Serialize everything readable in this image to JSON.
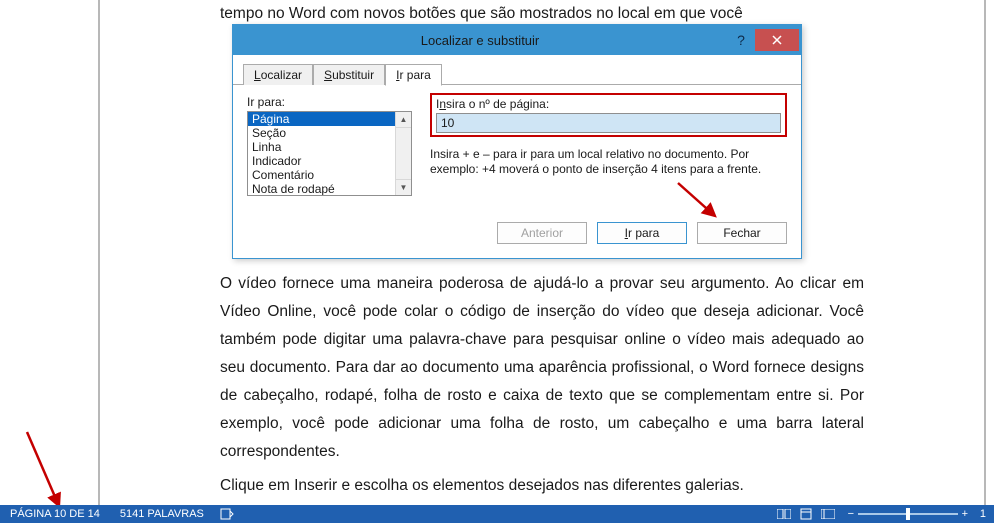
{
  "doc": {
    "top_line": "tempo no Word com novos botões que são mostrados no local em que você",
    "para2": "O vídeo fornece uma maneira poderosa de ajudá-lo a provar seu argumento. Ao clicar em Vídeo Online, você pode colar o código de inserção do vídeo que deseja adicionar. Você também pode digitar uma palavra-chave para pesquisar online o vídeo mais adequado ao seu documento. Para dar ao documento uma aparência profissional, o Word fornece designs de cabeçalho, rodapé, folha de rosto e caixa de texto que se complementam entre si. Por exemplo, você pode adicionar uma folha de rosto, um cabeçalho e uma barra lateral correspondentes.",
    "para3": "Clique em Inserir e escolha os elementos desejados nas diferentes galerias."
  },
  "dialog": {
    "title": "Localizar e substituir",
    "tabs": {
      "find": "ocalizar",
      "find_u": "L",
      "replace": "ubstituir",
      "replace_u": "S",
      "goto": "r para",
      "goto_u": "I"
    },
    "goto_label": "Ir para:",
    "list_items": [
      "Página",
      "Seção",
      "Linha",
      "Indicador",
      "Comentário",
      "Nota de rodapé"
    ],
    "page_label_pre": "I",
    "page_label_u": "n",
    "page_label_post": "sira o nº de página:",
    "page_value": "10",
    "help_text": "Insira + e – para ir para um local relativo no documento. Por exemplo: +4 moverá o ponto de inserção 4 itens para a frente.",
    "btn_prev": "Anterior",
    "btn_goto_u": "I",
    "btn_goto": "r para",
    "btn_close": "Fechar"
  },
  "statusbar": {
    "page": "PÁGINA 10 DE 14",
    "words": "5141 PALAVRAS",
    "zoom_value": "1",
    "minus": "−",
    "plus": "+"
  }
}
